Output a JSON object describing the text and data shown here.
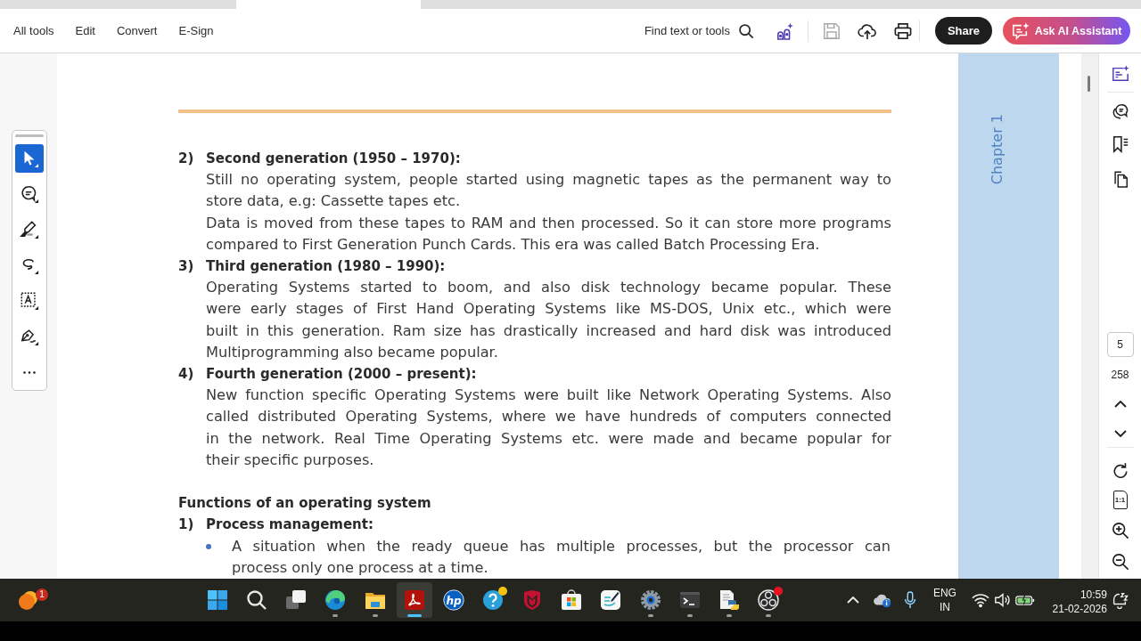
{
  "toolbar": {
    "menu": [
      {
        "label": "All tools"
      },
      {
        "label": "Edit"
      },
      {
        "label": "Convert"
      },
      {
        "label": "E-Sign"
      }
    ],
    "find_label": "Find text or tools",
    "save_disabled": true,
    "share_label": "Share",
    "ai_label": "Ask AI Assistant"
  },
  "tool_palette": {
    "tools": [
      {
        "kind": "select",
        "selected": true
      },
      {
        "kind": "comment",
        "selected": false
      },
      {
        "kind": "highlight",
        "selected": false
      },
      {
        "kind": "draw",
        "selected": false
      },
      {
        "kind": "text-box",
        "selected": false
      },
      {
        "kind": "sign",
        "selected": false
      },
      {
        "kind": "more",
        "selected": false
      }
    ]
  },
  "document": {
    "sections": [
      {
        "kind": "item",
        "number": "2)",
        "title": "Second generation (1950 – 1970):",
        "paragraphs": [
          {
            "lines": [
              "Still no operating system, people started using magnetic tapes as the permanent way to",
              "store data, e.g: Cassette tapes etc."
            ]
          },
          {
            "lines": [
              "Data is moved from these tapes to RAM and then processed. So it can store more programs",
              "compared to First Generation Punch Cards. This era was called Batch Processing Era."
            ]
          }
        ]
      },
      {
        "kind": "item",
        "number": "3)",
        "title": "Third generation (1980 – 1990):",
        "paragraphs": [
          {
            "lines": [
              "Operating Systems started to boom, and also disk technology became popular. These",
              "were early stages of First Hand Operating Systems like MS-DOS, Unix etc., which were",
              "built in this generation. Ram size has drastically increased and hard disk was introduced",
              "Multiprogramming also became popular."
            ]
          }
        ]
      },
      {
        "kind": "item",
        "number": "4)",
        "title": "Fourth generation (2000 – present):",
        "paragraphs": [
          {
            "lines": [
              "New function specific Operating Systems were built like Network Operating Systems. Also",
              "called distributed Operating Systems, where we have hundreds of computers connected",
              "in the network. Real Time Operating Systems etc. were made and became popular for",
              "their specific purposes."
            ]
          }
        ]
      },
      {
        "kind": "heading",
        "title": "Functions of an operating system"
      },
      {
        "kind": "item",
        "number": "1)",
        "title": "Process management:",
        "bullets": [
          {
            "lines": [
              "A situation when the ready queue has multiple processes, but the processor can",
              "process only one process at a time."
            ]
          }
        ]
      }
    ],
    "chapter_label": "Chapter 1"
  },
  "page_nav": {
    "page_value": "5",
    "page_count": "258",
    "fit_label": "1:1"
  },
  "taskbar": {
    "widget_badge": "1",
    "apps": [
      {
        "kind": "start",
        "running": false,
        "active": false
      },
      {
        "kind": "search",
        "running": false,
        "active": false
      },
      {
        "kind": "task-view",
        "running": false,
        "active": false
      },
      {
        "kind": "browser",
        "running": true,
        "active": false
      },
      {
        "kind": "folder",
        "running": true,
        "active": false
      },
      {
        "kind": "pdf",
        "running": true,
        "active": true
      },
      {
        "kind": "lettered-disc",
        "label": "hp",
        "running": false,
        "active": false
      },
      {
        "kind": "help",
        "running": false,
        "active": false,
        "color": "#f5c211"
      },
      {
        "kind": "shield",
        "running": false,
        "active": false
      },
      {
        "kind": "store",
        "running": false,
        "active": false
      },
      {
        "kind": "pen-note",
        "running": false,
        "active": false
      },
      {
        "kind": "gear",
        "running": true,
        "active": false
      },
      {
        "kind": "terminal",
        "running": true,
        "active": false
      },
      {
        "kind": "script",
        "running": true,
        "active": false
      },
      {
        "kind": "ring",
        "running": true,
        "active": false,
        "color": "#e81123"
      }
    ],
    "tray": {
      "language": "ENG",
      "region": "IN",
      "time": "10:59",
      "date": "21-02-2026"
    }
  }
}
